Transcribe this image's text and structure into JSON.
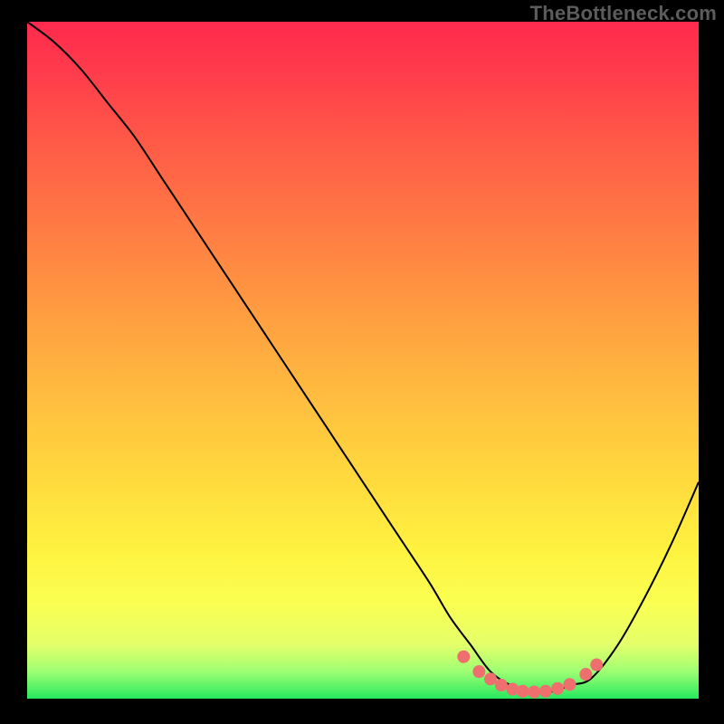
{
  "watermark": "TheBottleneck.com",
  "chart_data": {
    "type": "line",
    "title": "",
    "xlabel": "",
    "ylabel": "",
    "xlim": [
      0,
      100
    ],
    "ylim": [
      0,
      100
    ],
    "series": [
      {
        "name": "bottleneck-curve",
        "x": [
          0,
          4,
          8,
          12,
          16,
          20,
          24,
          28,
          32,
          36,
          40,
          44,
          48,
          52,
          56,
          60,
          63,
          66,
          69,
          72,
          75,
          78,
          81,
          84,
          88,
          92,
          96,
          100
        ],
        "y": [
          100,
          97,
          93,
          88,
          83,
          77,
          71,
          65,
          59,
          53,
          47,
          41,
          35,
          29,
          23,
          17,
          12,
          8,
          4,
          2,
          1,
          1,
          2,
          3,
          8,
          15,
          23,
          32
        ]
      }
    ],
    "markers": {
      "name": "highlight-dots",
      "x": [
        65.0,
        67.3,
        69.0,
        70.6,
        72.3,
        73.8,
        75.5,
        77.2,
        79.0,
        80.8,
        83.2,
        84.8
      ],
      "y": [
        6.2,
        4.0,
        2.9,
        2.0,
        1.4,
        1.1,
        1.0,
        1.1,
        1.5,
        2.1,
        3.6,
        5.0
      ]
    },
    "gradient_stops": [
      {
        "pos": 0,
        "color": "#ff2a4d"
      },
      {
        "pos": 8,
        "color": "#ff3d4b"
      },
      {
        "pos": 18,
        "color": "#ff5a47"
      },
      {
        "pos": 30,
        "color": "#ff7a44"
      },
      {
        "pos": 42,
        "color": "#ff9a41"
      },
      {
        "pos": 54,
        "color": "#ffb93f"
      },
      {
        "pos": 66,
        "color": "#ffd63e"
      },
      {
        "pos": 78,
        "color": "#fff23f"
      },
      {
        "pos": 86,
        "color": "#faff52"
      },
      {
        "pos": 92,
        "color": "#e4ff6a"
      },
      {
        "pos": 96,
        "color": "#9eff73"
      },
      {
        "pos": 100,
        "color": "#27e85e"
      }
    ],
    "colors": {
      "curve": "#000000",
      "marker": "#ef6e6e",
      "background": "#000000",
      "watermark": "#5c5c5c"
    }
  }
}
